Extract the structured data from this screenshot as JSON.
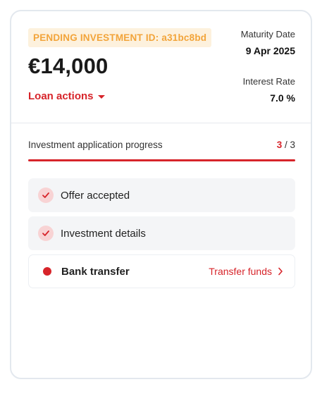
{
  "investment": {
    "badge": "PENDING INVESTMENT ID: a31bc8bd",
    "amount": "€14,000",
    "loan_actions_label": "Loan actions"
  },
  "meta": {
    "maturity_label": "Maturity Date",
    "maturity_value": "9 Apr 2025",
    "interest_label": "Interest Rate",
    "interest_value": "7.0 %"
  },
  "progress": {
    "label": "Investment application progress",
    "current": "3",
    "separator": " / ",
    "total": "3",
    "fraction": 1.0
  },
  "steps": [
    {
      "label": "Offer accepted",
      "status": "done",
      "icon": "check-icon"
    },
    {
      "label": "Investment details",
      "status": "done",
      "icon": "check-icon"
    },
    {
      "label": "Bank transfer",
      "status": "active",
      "icon": "dot-icon",
      "action": "Transfer funds"
    }
  ],
  "colors": {
    "accent": "#d7242a",
    "badge_bg": "#fdf1dd",
    "badge_text": "#f2a43a"
  }
}
